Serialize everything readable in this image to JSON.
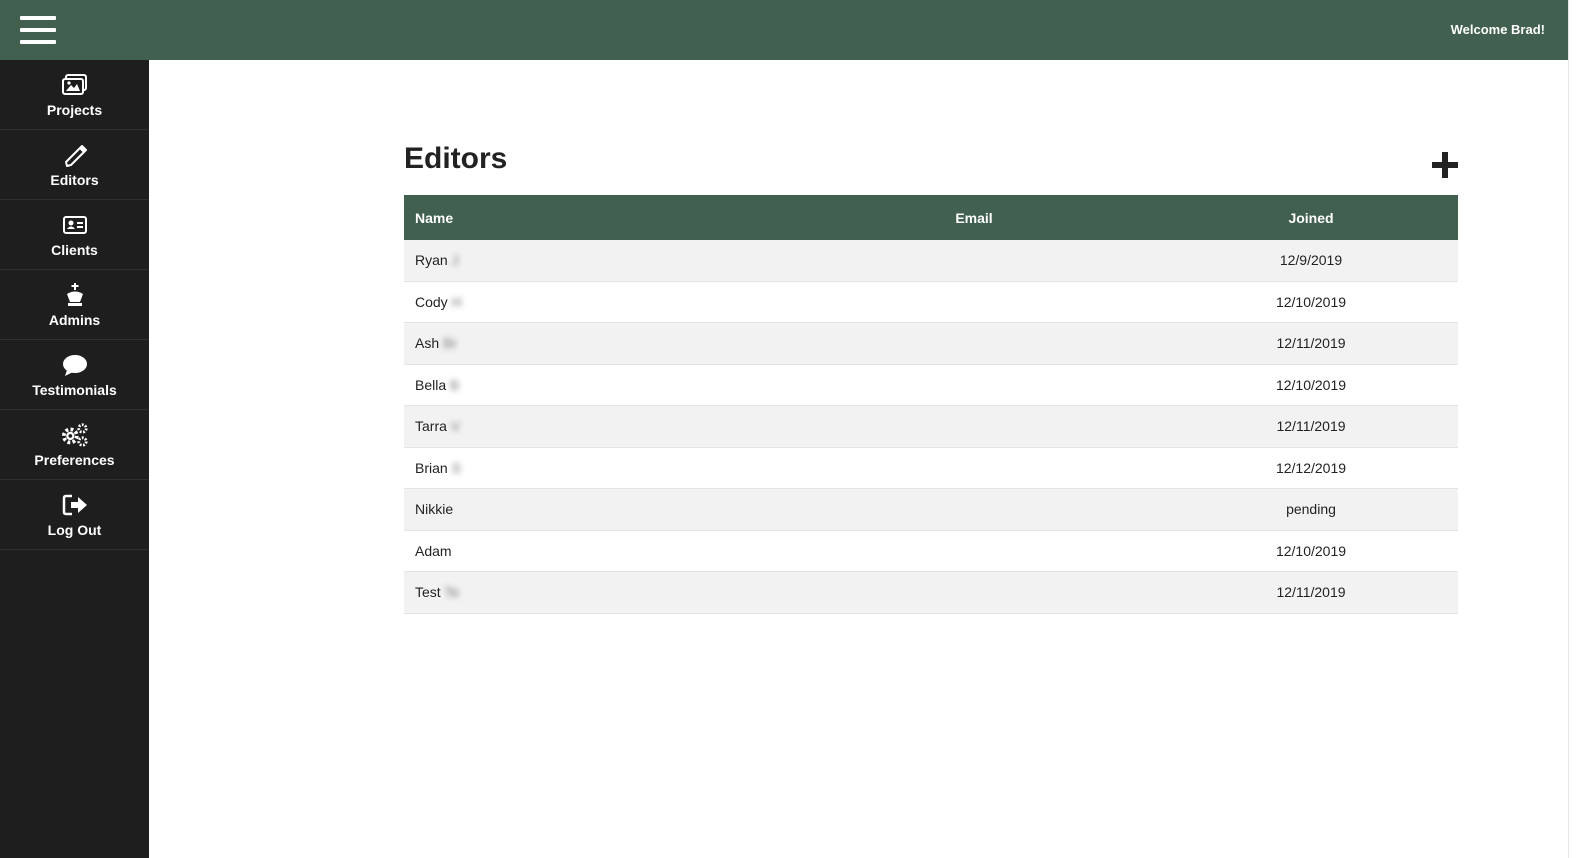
{
  "colors": {
    "topbar": "#41604f",
    "sidebar": "#1e1e1e",
    "table_header": "#41604f"
  },
  "header": {
    "welcome": "Welcome Brad!"
  },
  "sidebar": {
    "items": [
      {
        "label": "Projects",
        "icon": "images-icon"
      },
      {
        "label": "Editors",
        "icon": "pencil-icon"
      },
      {
        "label": "Clients",
        "icon": "id-card-icon"
      },
      {
        "label": "Admins",
        "icon": "king-icon"
      },
      {
        "label": "Testimonials",
        "icon": "speech-bubble-icon"
      },
      {
        "label": "Preferences",
        "icon": "gears-icon"
      },
      {
        "label": "Log Out",
        "icon": "sign-out-icon"
      }
    ]
  },
  "main": {
    "title": "Editors",
    "table": {
      "columns": [
        "Name",
        "Email",
        "Joined"
      ],
      "rows": [
        {
          "first": "Ryan",
          "rest": "J",
          "email": "",
          "joined": "12/9/2019"
        },
        {
          "first": "Cody",
          "rest": "H",
          "email": "",
          "joined": "12/10/2019"
        },
        {
          "first": "Ash",
          "rest": "Br",
          "email": "",
          "joined": "12/11/2019"
        },
        {
          "first": "Bella",
          "rest": "B",
          "email": "",
          "joined": "12/10/2019"
        },
        {
          "first": "Tarra",
          "rest": "V",
          "email": "",
          "joined": "12/11/2019"
        },
        {
          "first": "Brian",
          "rest": "S",
          "email": "",
          "joined": "12/12/2019"
        },
        {
          "first": "Nikkie",
          "rest": "",
          "email": "",
          "joined": "pending"
        },
        {
          "first": "Adam",
          "rest": "",
          "email": "",
          "joined": "12/10/2019"
        },
        {
          "first": "Test",
          "rest": "Te",
          "email": "",
          "joined": "12/11/2019"
        }
      ]
    }
  }
}
